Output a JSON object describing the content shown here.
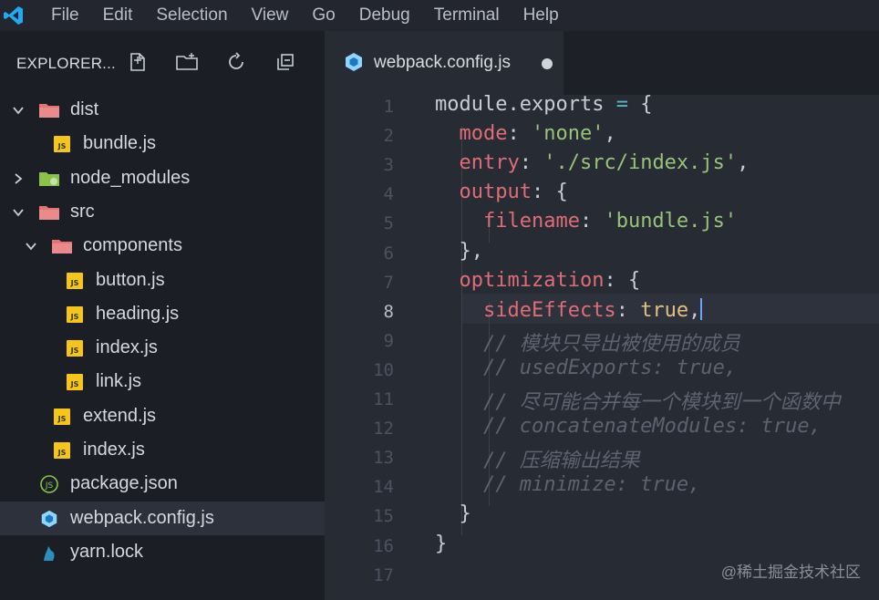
{
  "menu": [
    "File",
    "Edit",
    "Selection",
    "View",
    "Go",
    "Debug",
    "Terminal",
    "Help"
  ],
  "explorer": {
    "title": "EXPLORER..."
  },
  "tree": [
    {
      "label": "dist",
      "type": "folder-open",
      "depth": 0
    },
    {
      "label": "bundle.js",
      "type": "js",
      "depth": 1
    },
    {
      "label": "node_modules",
      "type": "folder-closed",
      "depth": 0
    },
    {
      "label": "src",
      "type": "folder-open",
      "depth": 0
    },
    {
      "label": "components",
      "type": "folder-open",
      "depth": 1
    },
    {
      "label": "button.js",
      "type": "js",
      "depth": 2
    },
    {
      "label": "heading.js",
      "type": "js",
      "depth": 2
    },
    {
      "label": "index.js",
      "type": "js",
      "depth": 2
    },
    {
      "label": "link.js",
      "type": "js",
      "depth": 2
    },
    {
      "label": "extend.js",
      "type": "js",
      "depth": 1
    },
    {
      "label": "index.js",
      "type": "js",
      "depth": 1
    },
    {
      "label": "package.json",
      "type": "json",
      "depth": 0
    },
    {
      "label": "webpack.config.js",
      "type": "webpack",
      "depth": 0,
      "selected": true
    },
    {
      "label": "yarn.lock",
      "type": "yarn",
      "depth": 0
    }
  ],
  "tab": {
    "label": "webpack.config.js",
    "modified": true
  },
  "editor": {
    "active_line": 8,
    "line_numbers": [
      "1",
      "2",
      "3",
      "4",
      "5",
      "6",
      "7",
      "8",
      "9",
      "10",
      "11",
      "12",
      "13",
      "14",
      "15",
      "16",
      "17"
    ],
    "code": [
      [
        [
          "p",
          "module"
        ],
        [
          "p",
          "."
        ],
        [
          "p",
          "exports"
        ],
        [
          "o",
          " = "
        ],
        [
          "p",
          "{"
        ]
      ],
      [
        [
          "p",
          "  "
        ],
        [
          "k",
          "mode"
        ],
        [
          "p",
          ": "
        ],
        [
          "s",
          "'none'"
        ],
        [
          "p",
          ","
        ]
      ],
      [
        [
          "p",
          "  "
        ],
        [
          "k",
          "entry"
        ],
        [
          "p",
          ": "
        ],
        [
          "s",
          "'./src/index.js'"
        ],
        [
          "p",
          ","
        ]
      ],
      [
        [
          "p",
          "  "
        ],
        [
          "k",
          "output"
        ],
        [
          "p",
          ": {"
        ]
      ],
      [
        [
          "p",
          "    "
        ],
        [
          "k",
          "filename"
        ],
        [
          "p",
          ": "
        ],
        [
          "s",
          "'bundle.js'"
        ]
      ],
      [
        [
          "p",
          "  },"
        ]
      ],
      [
        [
          "p",
          "  "
        ],
        [
          "k",
          "optimization"
        ],
        [
          "p",
          ": {"
        ]
      ],
      [
        [
          "p",
          "    "
        ],
        [
          "k",
          "sideEffects"
        ],
        [
          "p",
          ": "
        ],
        [
          "b",
          "true"
        ],
        [
          "p",
          ","
        ]
      ],
      [
        [
          "p",
          "    "
        ],
        [
          "c",
          "// 模块只导出被使用的成员"
        ]
      ],
      [
        [
          "p",
          "    "
        ],
        [
          "c",
          "// usedExports: true,"
        ]
      ],
      [
        [
          "p",
          "    "
        ],
        [
          "c",
          "// 尽可能合并每一个模块到一个函数中"
        ]
      ],
      [
        [
          "p",
          "    "
        ],
        [
          "c",
          "// concatenateModules: true,"
        ]
      ],
      [
        [
          "p",
          "    "
        ],
        [
          "c",
          "// 压缩输出结果"
        ]
      ],
      [
        [
          "p",
          "    "
        ],
        [
          "c",
          "// minimize: true,"
        ]
      ],
      [
        [
          "p",
          "  }"
        ]
      ],
      [
        [
          "p",
          "}"
        ]
      ],
      [
        [
          "p",
          ""
        ]
      ]
    ]
  },
  "watermark": "@稀土掘金技术社区",
  "colors": {
    "accent": "#23a9f2",
    "property": "#e06c75",
    "string": "#98c379",
    "bool": "#e5c07b",
    "comment": "#5c6370"
  }
}
